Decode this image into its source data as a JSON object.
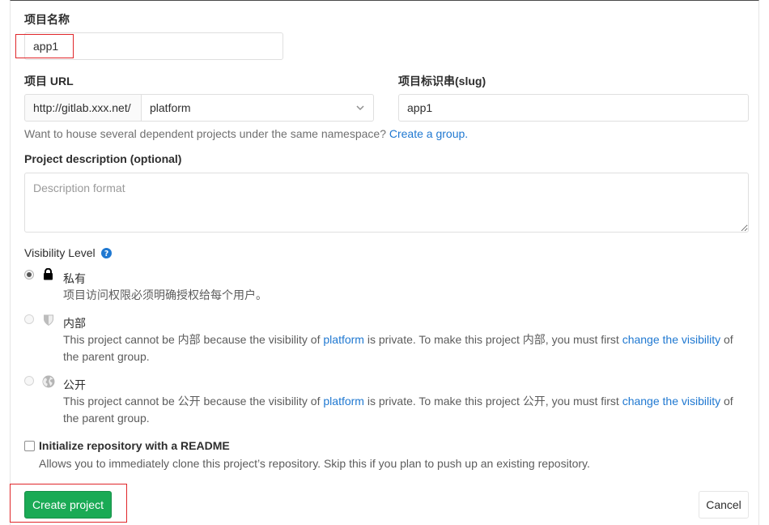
{
  "project_name": {
    "label": "项目名称",
    "value": "app1"
  },
  "project_url": {
    "label": "项目 URL",
    "prefix": "http://gitlab.xxx.net/",
    "namespace": "platform"
  },
  "slug": {
    "label": "项目标识串(slug)",
    "value": "app1"
  },
  "namespace_help": {
    "text": "Want to house several dependent projects under the same namespace? ",
    "link": "Create a group."
  },
  "description": {
    "label": "Project description (optional)",
    "placeholder": "Description format"
  },
  "visibility": {
    "label": "Visibility Level",
    "options": [
      {
        "title": "私有",
        "icon": "lock-icon",
        "desc": "项目访问权限必须明确授权给每个用户。",
        "checked": true
      },
      {
        "title": "内部",
        "icon": "shield-icon",
        "desc_a": "This project cannot be 内部 because the visibility of ",
        "desc_link1": "platform",
        "desc_b": " is private. To make this project 内部, you must first ",
        "desc_link2": "change the visibility",
        "desc_c": " of the parent group.",
        "checked": false
      },
      {
        "title": "公开",
        "icon": "globe-icon",
        "desc_a": "This project cannot be 公开 because the visibility of ",
        "desc_link1": "platform",
        "desc_b": " is private. To make this project 公开, you must first ",
        "desc_link2": "change the visibility",
        "desc_c": " of the parent group.",
        "checked": false
      }
    ]
  },
  "readme": {
    "label": "Initialize repository with a README",
    "help": "Allows you to immediately clone this project’s repository. Skip this if you plan to push up an existing repository."
  },
  "actions": {
    "create": "Create project",
    "cancel": "Cancel"
  },
  "colors": {
    "primary_green": "#1aaa55",
    "link_blue": "#1f78d1",
    "highlight_red": "#e0262a"
  }
}
